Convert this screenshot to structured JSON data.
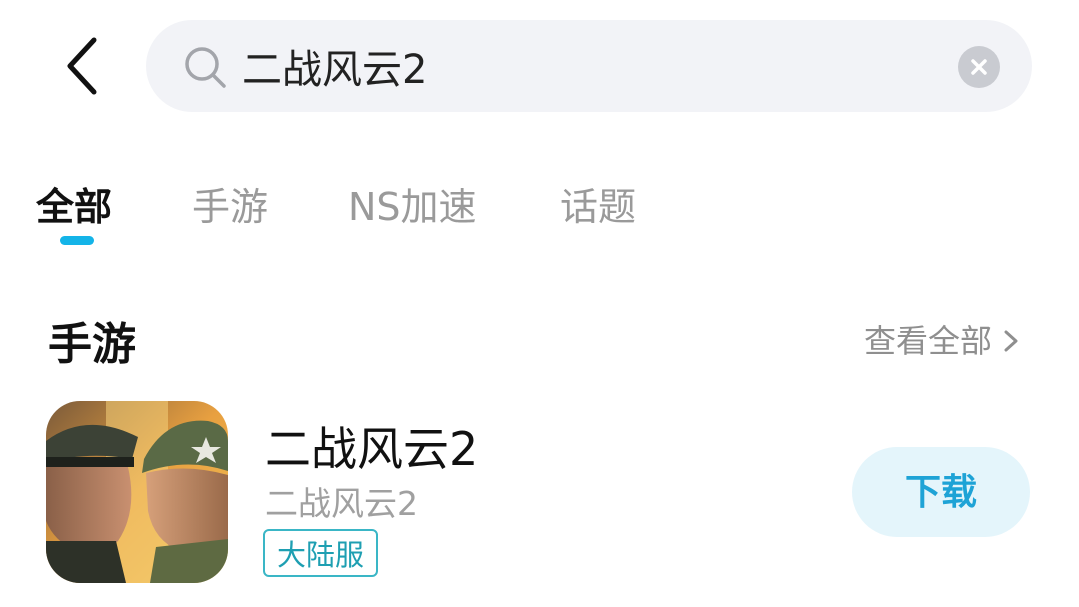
{
  "search": {
    "query": "二战风云2"
  },
  "tabs": [
    {
      "label": "全部"
    },
    {
      "label": "手游"
    },
    {
      "label": "NS加速"
    },
    {
      "label": "话题"
    }
  ],
  "section": {
    "title": "手游",
    "see_all": "查看全部"
  },
  "app": {
    "name": "二战风云2",
    "subtitle": "二战风云2",
    "tag": "大陆服",
    "download_label": "下载"
  },
  "colors": {
    "accent": "#14b4e8",
    "tag_border": "#3ab6c6",
    "download_bg": "#e4f5fb"
  },
  "icons": [
    "back-arrow-icon",
    "search-icon",
    "clear-icon",
    "chevron-right-icon"
  ]
}
